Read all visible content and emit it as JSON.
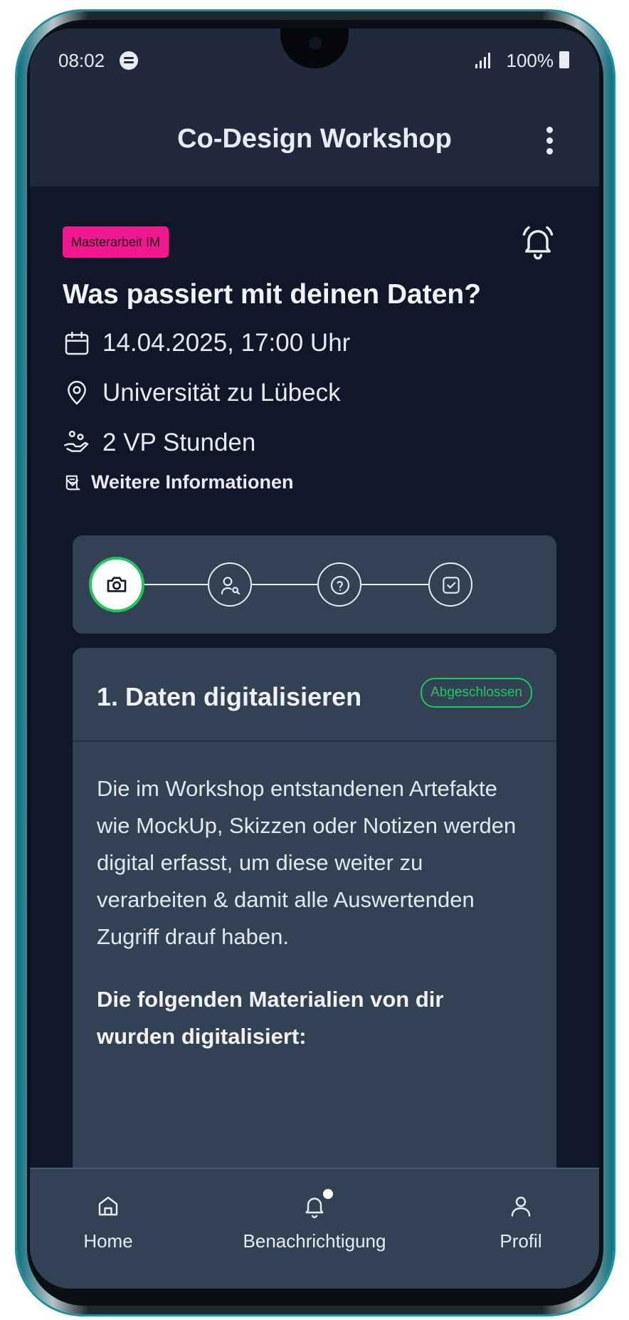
{
  "status_bar": {
    "time": "08:02",
    "battery": "100%"
  },
  "app_bar": {
    "title": "Co-Design Workshop"
  },
  "event": {
    "tag": "Masterarbeit IM",
    "title": "Was passiert mit deinen Daten?",
    "date": "14.04.2025, 17:00 Uhr",
    "location": "Universität zu Lübeck",
    "credits": "2 VP Stunden",
    "more_info": "Weitere Informationen"
  },
  "stepper": {
    "steps": [
      {
        "icon": "camera-icon",
        "active": true
      },
      {
        "icon": "user-search-icon",
        "active": false
      },
      {
        "icon": "help-circle-icon",
        "active": false
      },
      {
        "icon": "checkbox-icon",
        "active": false
      }
    ]
  },
  "step_card": {
    "title": "1. Daten digitalisieren",
    "status": "Abgeschlossen",
    "description": "Die im Workshop entstandenen Artefakte wie MockUp, Skizzen oder Notizen werden digital erfasst, um diese weiter zu verarbeiten & damit alle Auswertenden Zugriff drauf haben.",
    "subheading": "Die folgenden Materialien von dir wurden digitalisiert:"
  },
  "bottom_nav": {
    "items": [
      {
        "label": "Home",
        "icon": "home-icon"
      },
      {
        "label": "Benachrichtigung",
        "icon": "bell-icon",
        "badge": true
      },
      {
        "label": "Profil",
        "icon": "user-icon"
      }
    ]
  },
  "colors": {
    "background": "#0f1729",
    "surface": "#334155",
    "appbar": "#202a3c",
    "tag": "#f0188e",
    "success": "#22c55e"
  }
}
